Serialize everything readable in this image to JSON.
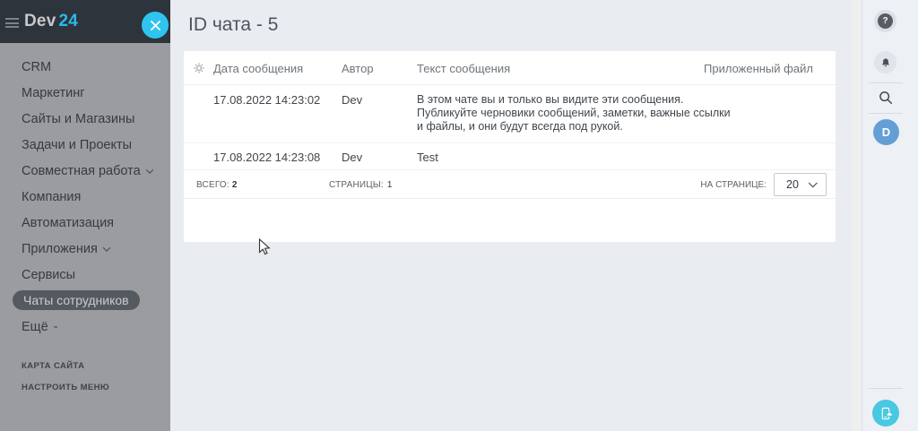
{
  "header": {
    "brand": "Dev",
    "brand_accent": "24"
  },
  "sidebar": {
    "items": [
      {
        "label": "CRM"
      },
      {
        "label": "Маркетинг"
      },
      {
        "label": "Сайты и Магазины"
      },
      {
        "label": "Задачи и Проекты"
      },
      {
        "label": "Совместная работа",
        "has_chevron": true
      },
      {
        "label": "Компания"
      },
      {
        "label": "Автоматизация"
      },
      {
        "label": "Приложения",
        "has_chevron": true
      },
      {
        "label": "Сервисы"
      },
      {
        "label": "Чаты сотрудников",
        "active": true
      },
      {
        "label": "Ещё",
        "suffix": "-"
      }
    ],
    "footer_links": [
      {
        "label": "КАРТА САЙТА"
      },
      {
        "label": "НАСТРОИТЬ МЕНЮ"
      }
    ]
  },
  "main": {
    "title": "ID чата - 5",
    "table": {
      "columns": [
        "Дата сообщения",
        "Автор",
        "Текст сообщения",
        "Приложенный файл"
      ],
      "rows": [
        {
          "date": "17.08.2022 14:23:02",
          "author": "Dev",
          "text": "В этом чате вы и только вы видите эти сообщения.\nПубликуйте черновики сообщений, заметки, важные ссылки\nи файлы, и они будут всегда под рукой.",
          "file": ""
        },
        {
          "date": "17.08.2022 14:23:08",
          "author": "Dev",
          "text": "Test",
          "file": ""
        }
      ],
      "footer": {
        "total_label": "ВСЕГО:",
        "total_value": "2",
        "pages_label": "СТРАНИЦЫ:",
        "pages_value": "1",
        "per_page_label": "НА СТРАНИЦЕ:",
        "per_page_value": "20"
      }
    }
  },
  "right_rail": {
    "help_glyph": "?",
    "avatar_initial": "D"
  },
  "colors": {
    "header_dark": "#2e343c",
    "accent_cyan": "#2fc4f0",
    "sidebar_gray": "#9a9c9f",
    "active_pill_bg": "#555a60",
    "content_bg": "#e9edf1",
    "avatar_blue": "#639fd4",
    "app_button_cyan": "#49c8e2"
  }
}
